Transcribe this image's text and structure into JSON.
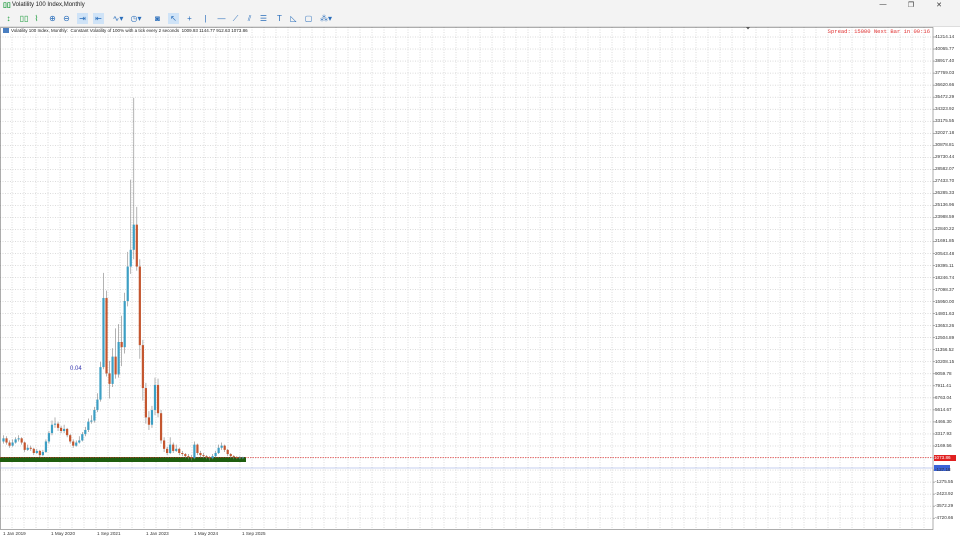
{
  "window": {
    "title": "Volatility 100 Index,Monthly",
    "controls": [
      "minimize",
      "restore",
      "close"
    ]
  },
  "toolbar": {
    "buttons": [
      {
        "name": "new-order-icon",
        "glyph": "↕",
        "sel": false,
        "green": true
      },
      {
        "name": "candlesticks-icon",
        "glyph": "▯▯",
        "sel": false,
        "green": true
      },
      {
        "name": "line-chart-icon",
        "glyph": "⌇",
        "sel": false,
        "green": true
      },
      {
        "name": "zoom-in-icon",
        "glyph": "⊕",
        "sel": false
      },
      {
        "name": "zoom-out-icon",
        "glyph": "⊖",
        "sel": false
      },
      {
        "name": "autoscroll-icon",
        "glyph": "⇥",
        "sel": true
      },
      {
        "name": "chart-shift-icon",
        "glyph": "⇤",
        "sel": true
      },
      {
        "name": "indicators-icon",
        "glyph": "∿▾",
        "sel": false
      },
      {
        "name": "periods-icon",
        "glyph": "◷▾",
        "sel": false
      },
      {
        "name": "screenshot-icon",
        "glyph": "◙",
        "sel": false
      },
      {
        "name": "cursor-icon",
        "glyph": "↖",
        "sel": true
      },
      {
        "name": "crosshair-icon",
        "glyph": "+",
        "sel": false
      },
      {
        "name": "vertical-line-icon",
        "glyph": "|",
        "sel": false
      },
      {
        "name": "horizontal-line-icon",
        "glyph": "—",
        "sel": false
      },
      {
        "name": "trendline-icon",
        "glyph": "⟋",
        "sel": false
      },
      {
        "name": "channel-icon",
        "glyph": "⫽",
        "sel": false
      },
      {
        "name": "fibonacci-icon",
        "glyph": "☰",
        "sel": false
      },
      {
        "name": "text-icon",
        "glyph": "T",
        "sel": false
      },
      {
        "name": "arrow-label-icon",
        "glyph": "◺",
        "sel": false
      },
      {
        "name": "shapes-icon",
        "glyph": "▢",
        "sel": false
      },
      {
        "name": "more-objects-icon",
        "glyph": "⁂▾",
        "sel": false
      }
    ]
  },
  "chart": {
    "info": "Volatility 100 Index, Monthly:  Constant Volatility of 100% with a tick every 2 seconds  1009.93 1144.77 912.63 1073.86",
    "spread": "Spread: 15000 Next Bar in 00:16",
    "label": "0.04",
    "current_price": "1073.86",
    "price_ticks": [
      "41214.14",
      "40065.77",
      "38917.40",
      "37769.03",
      "36620.66",
      "35472.29",
      "34323.92",
      "33175.55",
      "32027.18",
      "30878.81",
      "29730.44",
      "28582.07",
      "27433.70",
      "26285.33",
      "25136.96",
      "23988.59",
      "22840.22",
      "21691.85",
      "20543.48",
      "19395.11",
      "18246.74",
      "17098.37",
      "15950.00",
      "14801.63",
      "13653.26",
      "12504.89",
      "11356.52",
      "10208.15",
      "9059.78",
      "7911.41",
      "6763.04",
      "5614.67",
      "4466.30",
      "3317.93",
      "2169.56",
      "1021.19",
      "-127.18",
      "-1275.55",
      "-2423.92",
      "-3572.29",
      "-4720.66"
    ],
    "time_ticks": [
      "1 Jan 2019",
      "1 May 2020",
      "1 Sep 2021",
      "1 Jan 2023",
      "1 May 2024",
      "1 Sep 2025"
    ],
    "colors": {
      "bull": "#3d9fc4",
      "bear": "#c4562f",
      "wick": "#808080",
      "grid": "#b8b8b8",
      "bid_line": "#e03030",
      "ask_line": "#8aa0e0",
      "band": "#1e5e10"
    }
  },
  "chart_data": {
    "type": "candlestick",
    "timeframe": "Monthly",
    "symbol": "Volatility 100 Index",
    "start": "Jan 2019",
    "ylim": [
      -4720.66,
      41214.14
    ],
    "grid": true,
    "ohlc": [
      [
        2600,
        3200,
        2400,
        2900
      ],
      [
        2900,
        3100,
        2300,
        2500
      ],
      [
        2500,
        2700,
        2000,
        2200
      ],
      [
        2200,
        2800,
        2100,
        2500
      ],
      [
        2500,
        3000,
        2400,
        2800
      ],
      [
        2800,
        3200,
        2600,
        2900
      ],
      [
        2900,
        3000,
        2300,
        2500
      ],
      [
        2500,
        2600,
        1600,
        1800
      ],
      [
        1800,
        2300,
        1700,
        2000
      ],
      [
        2000,
        2200,
        1700,
        1900
      ],
      [
        1900,
        2000,
        1300,
        1500
      ],
      [
        1500,
        1900,
        1400,
        1700
      ],
      [
        1700,
        1800,
        1100,
        1300
      ],
      [
        1300,
        1800,
        1200,
        1600
      ],
      [
        1600,
        2800,
        1500,
        2600
      ],
      [
        2600,
        3600,
        2400,
        3400
      ],
      [
        3400,
        4600,
        3200,
        4200
      ],
      [
        4200,
        4900,
        3900,
        4300
      ],
      [
        4300,
        4500,
        3600,
        3900
      ],
      [
        3900,
        4100,
        3400,
        3600
      ],
      [
        3600,
        4200,
        3400,
        3800
      ],
      [
        3800,
        3900,
        3000,
        3200
      ],
      [
        3200,
        3300,
        2400,
        2600
      ],
      [
        2600,
        2800,
        2000,
        2200
      ],
      [
        2200,
        2700,
        2100,
        2500
      ],
      [
        2500,
        3100,
        2400,
        2700
      ],
      [
        2700,
        3500,
        2600,
        3300
      ],
      [
        3300,
        4000,
        3100,
        3700
      ],
      [
        3700,
        4800,
        3500,
        4500
      ],
      [
        4500,
        5100,
        4300,
        4600
      ],
      [
        4600,
        5900,
        4400,
        5600
      ],
      [
        5600,
        7200,
        5400,
        6600
      ],
      [
        6600,
        10200,
        6400,
        9700
      ],
      [
        9700,
        18700,
        9500,
        16300
      ],
      [
        16300,
        17000,
        8800,
        9100
      ],
      [
        9100,
        10300,
        6700,
        8100
      ],
      [
        8100,
        11500,
        7800,
        10700
      ],
      [
        10700,
        13400,
        8600,
        9000
      ],
      [
        9000,
        13800,
        8700,
        12100
      ],
      [
        12100,
        14600,
        9800,
        11600
      ],
      [
        11600,
        16800,
        11000,
        16000
      ],
      [
        16000,
        20700,
        15500,
        19300
      ],
      [
        19300,
        27600,
        18600,
        20900
      ],
      [
        20900,
        35400,
        20000,
        23300
      ],
      [
        23300,
        25000,
        18900,
        19300
      ],
      [
        19300,
        20000,
        10500,
        11800
      ],
      [
        11800,
        12300,
        6500,
        7700
      ],
      [
        7700,
        8200,
        4300,
        4900
      ],
      [
        4900,
        5500,
        3700,
        4200
      ],
      [
        4200,
        6000,
        3900,
        5600
      ],
      [
        5600,
        8700,
        5100,
        8000
      ],
      [
        8000,
        8600,
        4900,
        5300
      ],
      [
        5300,
        5600,
        2400,
        2700
      ],
      [
        2700,
        3000,
        1600,
        1900
      ],
      [
        1900,
        2100,
        1300,
        1500
      ],
      [
        1500,
        3000,
        1400,
        2300
      ],
      [
        2300,
        2500,
        1500,
        1700
      ],
      [
        1700,
        2300,
        1600,
        1900
      ],
      [
        1900,
        2000,
        1300,
        1500
      ],
      [
        1500,
        1700,
        1200,
        1400
      ],
      [
        1400,
        1500,
        1000,
        1200
      ],
      [
        1200,
        1400,
        900,
        1100
      ],
      [
        1100,
        1300,
        800,
        1000
      ],
      [
        1000,
        2600,
        900,
        2300
      ],
      [
        2300,
        2400,
        1300,
        1500
      ],
      [
        1500,
        1700,
        1100,
        1300
      ],
      [
        1300,
        1500,
        1000,
        1200
      ],
      [
        1200,
        1300,
        900,
        1100
      ],
      [
        1100,
        1200,
        800,
        1000
      ],
      [
        1000,
        1400,
        900,
        1200
      ],
      [
        1200,
        1700,
        1100,
        1500
      ],
      [
        1500,
        2300,
        1400,
        2000
      ],
      [
        2000,
        2500,
        1800,
        2200
      ],
      [
        2200,
        2300,
        1600,
        1800
      ],
      [
        1800,
        1900,
        1200,
        1400
      ],
      [
        1400,
        1500,
        1000,
        1200
      ],
      [
        1200,
        1300,
        900,
        1100
      ],
      [
        1100,
        1200,
        900,
        1000
      ],
      [
        1000,
        1200,
        900,
        1050
      ],
      [
        1009.93,
        1144.77,
        912.63,
        1073.86
      ]
    ]
  }
}
